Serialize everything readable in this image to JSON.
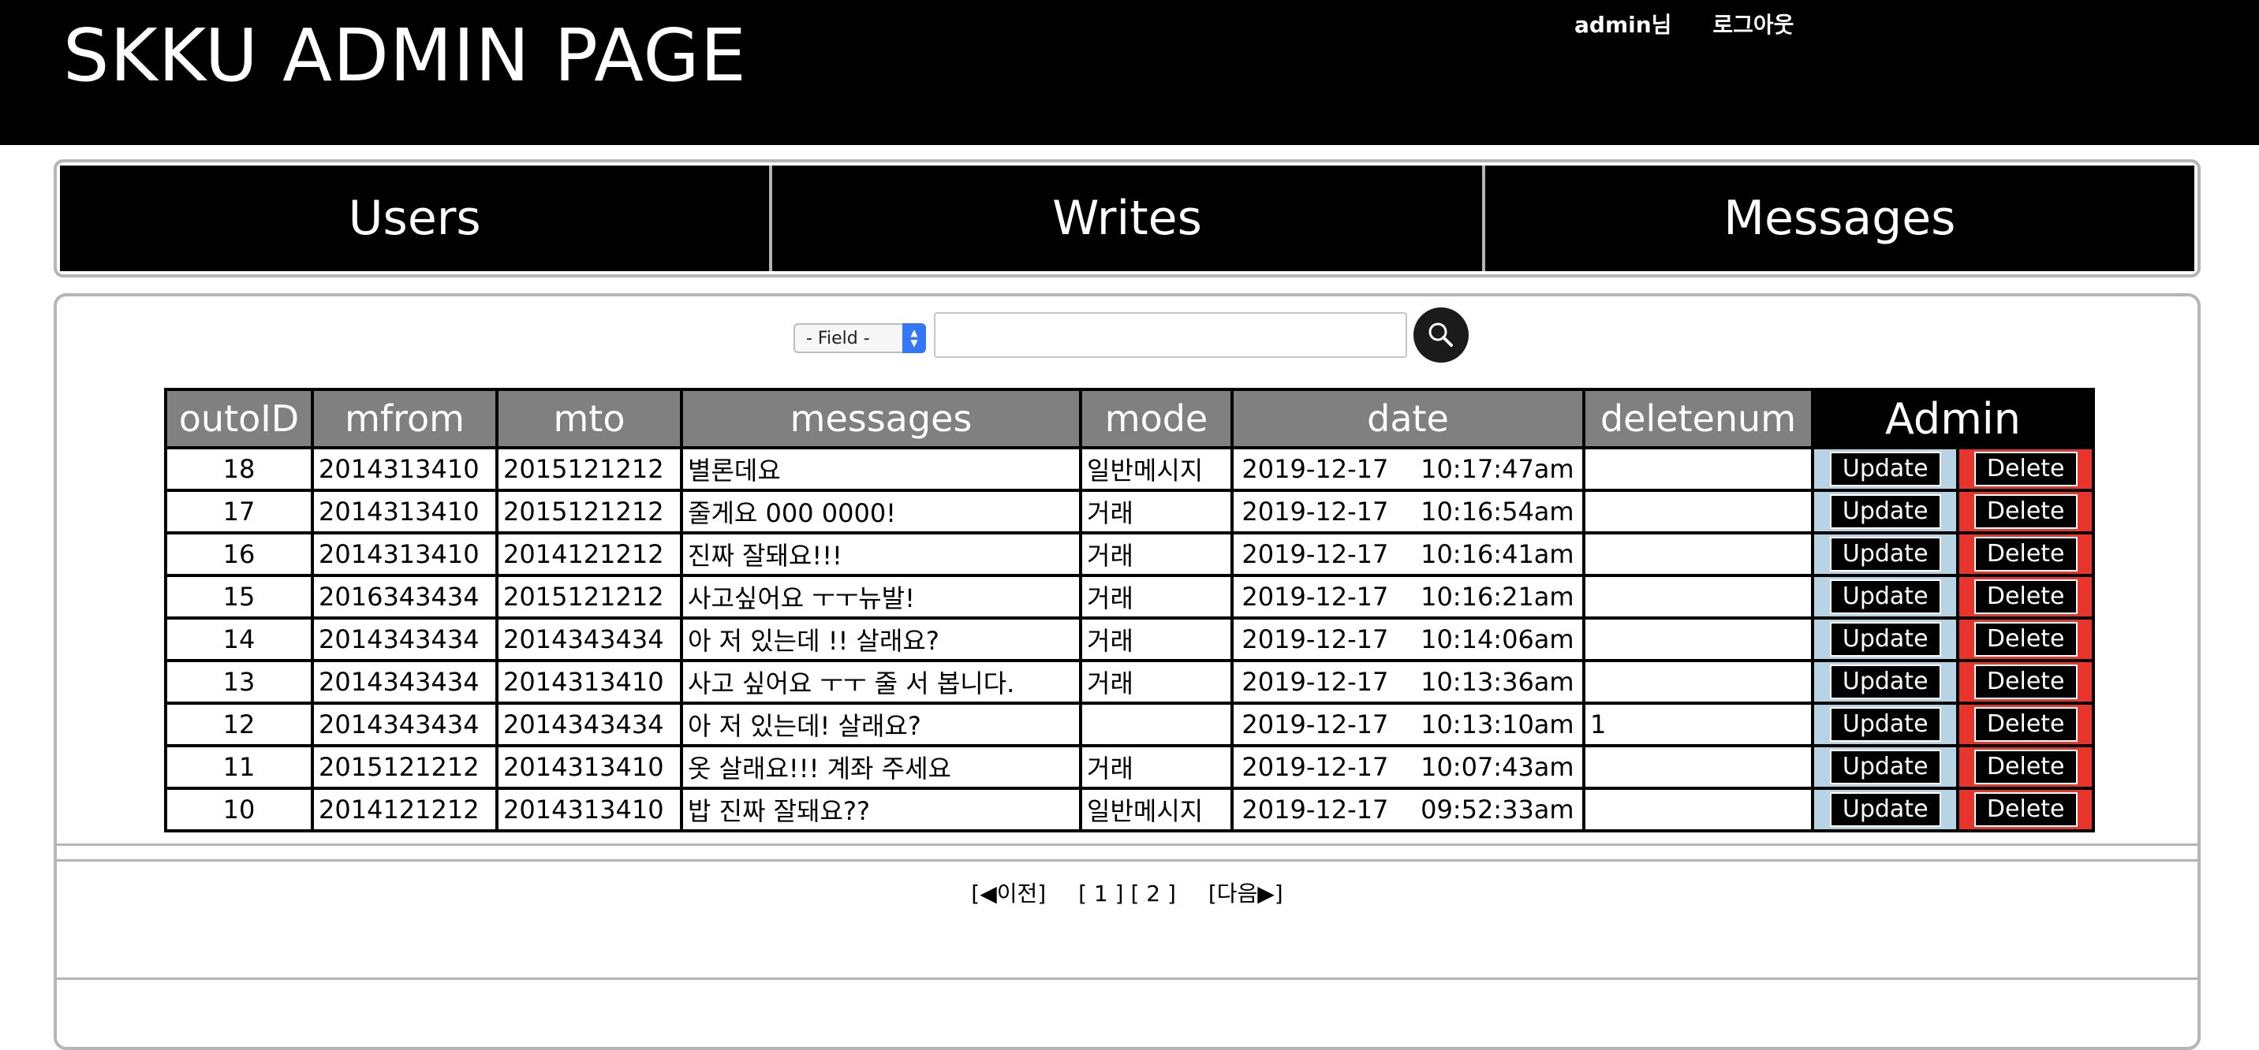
{
  "header": {
    "title": "SKKU ADMIN PAGE",
    "user_label": "admin님",
    "logout_label": "로그아웃"
  },
  "nav": {
    "tabs": [
      {
        "label": "Users"
      },
      {
        "label": "Writes"
      },
      {
        "label": "Messages"
      }
    ]
  },
  "search": {
    "field_select_value": "- Field -",
    "input_value": "",
    "button_icon": "search-icon"
  },
  "table": {
    "columns": [
      "outoID",
      "mfrom",
      "mto",
      "messages",
      "mode",
      "date",
      "deletenum",
      "Admin"
    ],
    "update_label": "Update",
    "delete_label": "Delete",
    "rows": [
      {
        "id": "18",
        "mfrom": "2014313410",
        "mto": "2015121212",
        "message": "별론데요",
        "mode": "일반메시지",
        "date": "2019-12-17    10:17:47am",
        "deletenum": ""
      },
      {
        "id": "17",
        "mfrom": "2014313410",
        "mto": "2015121212",
        "message": "줄게요 000 0000!",
        "mode": "거래",
        "date": "2019-12-17    10:16:54am",
        "deletenum": ""
      },
      {
        "id": "16",
        "mfrom": "2014313410",
        "mto": "2014121212",
        "message": "진짜 잘돼요!!!",
        "mode": "거래",
        "date": "2019-12-17    10:16:41am",
        "deletenum": ""
      },
      {
        "id": "15",
        "mfrom": "2016343434",
        "mto": "2015121212",
        "message": "사고싶어요 ㅜㅜ뉴발!",
        "mode": "거래",
        "date": "2019-12-17    10:16:21am",
        "deletenum": ""
      },
      {
        "id": "14",
        "mfrom": "2014343434",
        "mto": "2014343434",
        "message": "아 저 있는데 !! 살래요?",
        "mode": "거래",
        "date": "2019-12-17    10:14:06am",
        "deletenum": ""
      },
      {
        "id": "13",
        "mfrom": "2014343434",
        "mto": "2014313410",
        "message": "사고 싶어요 ㅜㅜ 줄 서 봅니다.",
        "mode": "거래",
        "date": "2019-12-17    10:13:36am",
        "deletenum": ""
      },
      {
        "id": "12",
        "mfrom": "2014343434",
        "mto": "2014343434",
        "message": "아 저 있는데! 살래요?",
        "mode": "",
        "date": "2019-12-17    10:13:10am",
        "deletenum": "1"
      },
      {
        "id": "11",
        "mfrom": "2015121212",
        "mto": "2014313410",
        "message": "옷 살래요!!! 계좌 주세요",
        "mode": "거래",
        "date": "2019-12-17    10:07:43am",
        "deletenum": ""
      },
      {
        "id": "10",
        "mfrom": "2014121212",
        "mto": "2014313410",
        "message": "밥 진짜 잘돼요??",
        "mode": "일반메시지",
        "date": "2019-12-17    09:52:33am",
        "deletenum": ""
      }
    ]
  },
  "pagination": {
    "prev_label": "[◀이전]",
    "page_1": "[ 1 ]",
    "page_2": "[ 2 ]",
    "next_label": "[다음▶]"
  }
}
